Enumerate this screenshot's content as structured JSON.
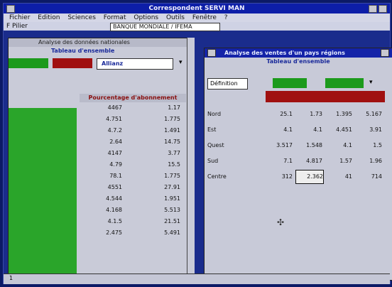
{
  "app": {
    "title": "Correspondent SERVI MAN"
  },
  "menu": [
    "Fichier",
    "Edition",
    "Sciences",
    "Format",
    "Options",
    "Outils",
    "Fenêtre",
    "?"
  ],
  "toolbar": {
    "label": "F Pilier",
    "field": "BANQUE MONDIALE / IFEMA"
  },
  "left_window": {
    "title": "Analyse des données nationales",
    "link": "Tableau d'ensemble",
    "field_value": "Allianz",
    "table_header": "Pourcentage d'abonnement",
    "rows": [
      {
        "a": "4467",
        "b": "1.17"
      },
      {
        "a": "4.751",
        "b": "1.775"
      },
      {
        "a": "4.7.2",
        "b": "1.491"
      },
      {
        "a": "2.64",
        "b": "14.75"
      },
      {
        "a": "4147",
        "b": "3.77"
      },
      {
        "a": "4.79",
        "b": "15.5"
      },
      {
        "a": "78.1",
        "b": "1.775"
      },
      {
        "a": "4551",
        "b": "27.91"
      },
      {
        "a": "4.544",
        "b": "1.951"
      },
      {
        "a": "4.168",
        "b": "5.513"
      },
      {
        "a": "4.1.5",
        "b": "21.51"
      },
      {
        "a": "2.475",
        "b": "5.491"
      }
    ]
  },
  "right_window": {
    "title": "Analyse des ventes d'un pays régions",
    "subtitle": "Tableau d'ensemble",
    "control_label": "Définition",
    "rows": [
      {
        "label": "Nord",
        "v": [
          "25.1",
          "1.73",
          "1.395",
          "5.167"
        ]
      },
      {
        "label": "Est",
        "v": [
          "4.1",
          "4.1",
          "4.451",
          "3.91"
        ]
      },
      {
        "label": "Quest",
        "v": [
          "3.517",
          "1.548",
          "4.1",
          "1.5"
        ]
      },
      {
        "label": "Sud",
        "v": [
          "7.1",
          "4.817",
          "1.57",
          "1.96"
        ]
      },
      {
        "label": "Centre",
        "v": [
          "312",
          "2.362",
          "41",
          "714"
        ]
      }
    ],
    "selected_cell": "2.362"
  },
  "status": {
    "left": "1"
  },
  "colors": {
    "accent_blue": "#1423a8",
    "green": "#2aa52a",
    "red": "#a01010"
  }
}
